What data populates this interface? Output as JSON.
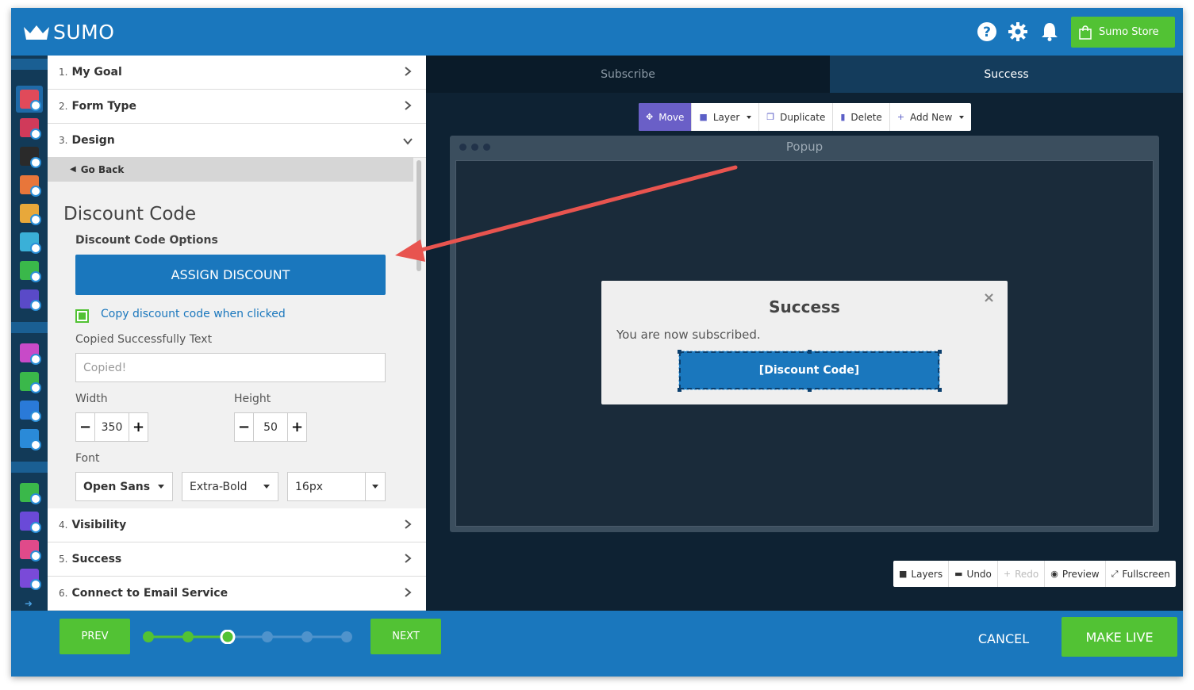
{
  "app": {
    "logo_text": "SUMO",
    "store_label": "Sumo Store"
  },
  "top_icons": [
    "help-icon",
    "gear-icon",
    "bell-icon"
  ],
  "steps": [
    {
      "num": "1.",
      "label": "My Goal"
    },
    {
      "num": "2.",
      "label": "Form Type"
    },
    {
      "num": "3.",
      "label": "Design"
    },
    {
      "num": "4.",
      "label": "Visibility"
    },
    {
      "num": "5.",
      "label": "Success"
    },
    {
      "num": "6.",
      "label": "Connect to Email Service"
    }
  ],
  "design_panel": {
    "go_back": "Go Back",
    "title": "Discount Code",
    "options_heading": "Discount Code Options",
    "assign_button": "ASSIGN DISCOUNT",
    "copy_checkbox_label": "Copy discount code when clicked",
    "copy_checked": true,
    "copied_text_label": "Copied Successfully Text",
    "copied_text_placeholder": "Copied!",
    "width_label": "Width",
    "width_value": "350",
    "height_label": "Height",
    "height_value": "50",
    "font_label": "Font",
    "font_family": "Open Sans",
    "font_weight": "Extra-Bold",
    "font_size": "16px"
  },
  "footer": {
    "prev": "PREV",
    "next": "NEXT",
    "cancel": "CANCEL",
    "make_live": "MAKE LIVE",
    "progress": {
      "total": 6,
      "current": 3
    }
  },
  "editor": {
    "tabs": [
      "Subscribe",
      "Success"
    ],
    "active_tab": "Success",
    "toolbar": [
      "Move",
      "Layer",
      "Duplicate",
      "Delete",
      "Add New"
    ],
    "window_title": "Popup",
    "success_popup": {
      "title": "Success",
      "message": "You are now subscribed.",
      "discount_button": "[Discount Code]",
      "close": "×"
    },
    "bottom_tools": [
      "Layers",
      "Undo",
      "Redo",
      "Preview",
      "Fullscreen"
    ]
  },
  "colors": {
    "brand_blue": "#1a77bd",
    "green": "#52c234",
    "editor_bg": "#0e2233",
    "move_purple": "#6a5fc7",
    "annotation_red": "#e8544f"
  }
}
